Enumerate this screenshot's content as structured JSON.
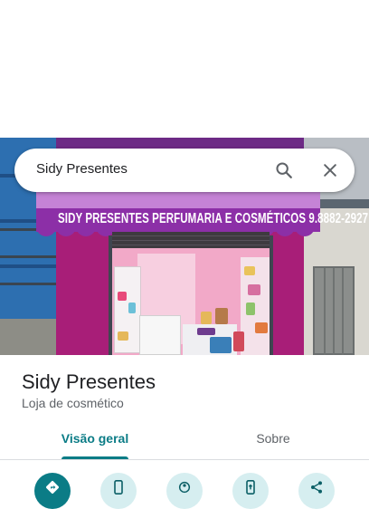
{
  "search": {
    "query": "Sidy Presentes"
  },
  "photo": {
    "awning_text": "SIDY PRESENTES PERFUMARIA E COSMÉTICOS  9.8882-2927"
  },
  "place": {
    "name": "Sidy Presentes",
    "category": "Loja de cosmético"
  },
  "tabs": [
    {
      "label": "Visão geral",
      "selected": true
    },
    {
      "label": "Sobre",
      "selected": false
    }
  ],
  "actions": [
    {
      "icon": "directions-icon"
    },
    {
      "icon": "phone-icon"
    },
    {
      "icon": "street-view-icon"
    },
    {
      "icon": "send-to-phone-icon"
    },
    {
      "icon": "share-icon"
    }
  ],
  "colors": {
    "accent": "#0b7c86",
    "accent_light": "#d6eef0",
    "awning": "#8c2fa7",
    "facade": "#a81e78"
  }
}
